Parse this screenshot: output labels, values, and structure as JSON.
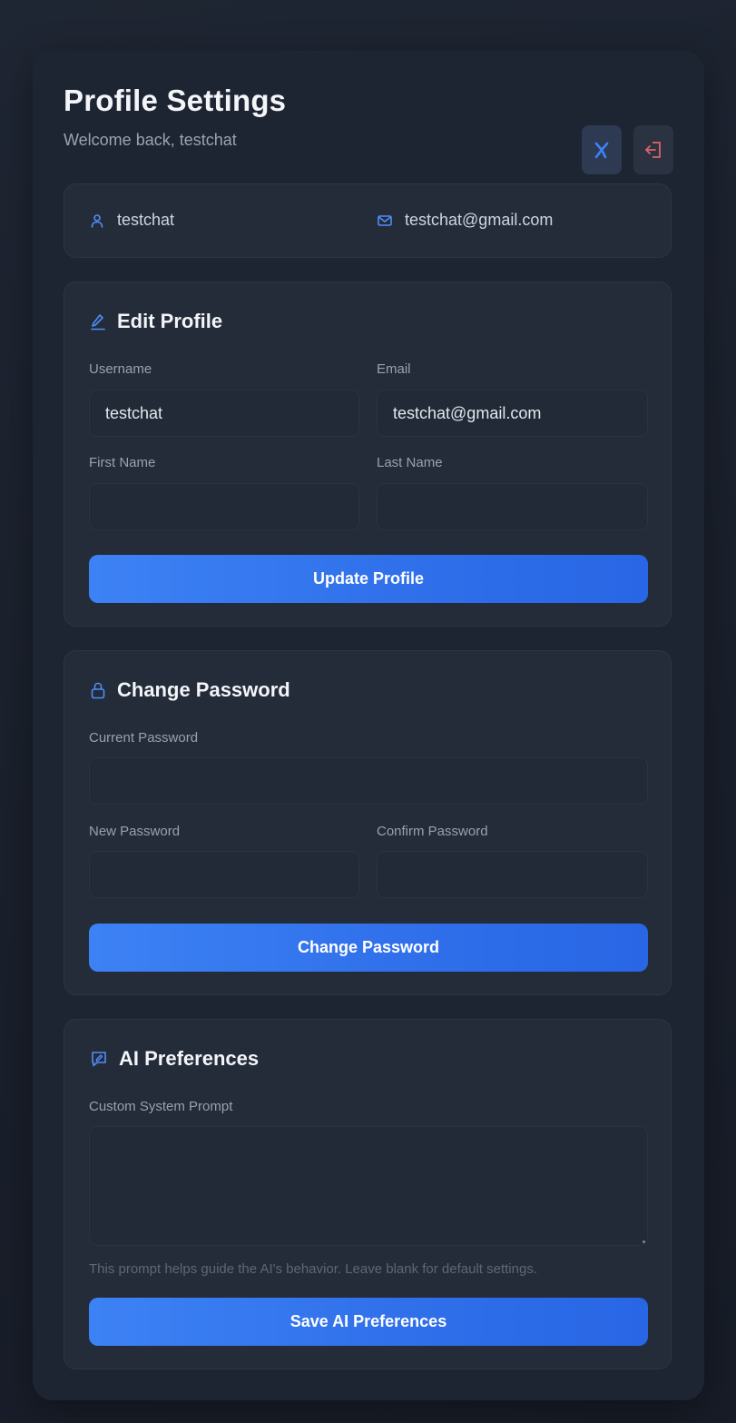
{
  "header": {
    "title": "Profile Settings",
    "subtitle": "Welcome back, testchat",
    "language_icon": "language-switch-icon",
    "logout_icon": "logout-icon"
  },
  "info": {
    "username": "testchat",
    "email": "testchat@gmail.com"
  },
  "edit_profile": {
    "title": "Edit Profile",
    "username_label": "Username",
    "username_value": "testchat",
    "email_label": "Email",
    "email_value": "testchat@gmail.com",
    "first_name_label": "First Name",
    "first_name_value": "",
    "last_name_label": "Last Name",
    "last_name_value": "",
    "submit_label": "Update Profile"
  },
  "change_password": {
    "title": "Change Password",
    "current_label": "Current Password",
    "new_label": "New Password",
    "confirm_label": "Confirm Password",
    "submit_label": "Change Password"
  },
  "ai_preferences": {
    "title": "AI Preferences",
    "prompt_label": "Custom System Prompt",
    "prompt_value": "",
    "help_text": "This prompt helps guide the AI's behavior. Leave blank for default settings.",
    "submit_label": "Save AI Preferences"
  },
  "colors": {
    "accent": "#3b82f6",
    "danger": "#e0626b",
    "background": "#1a202c",
    "card": "#242c3a"
  }
}
